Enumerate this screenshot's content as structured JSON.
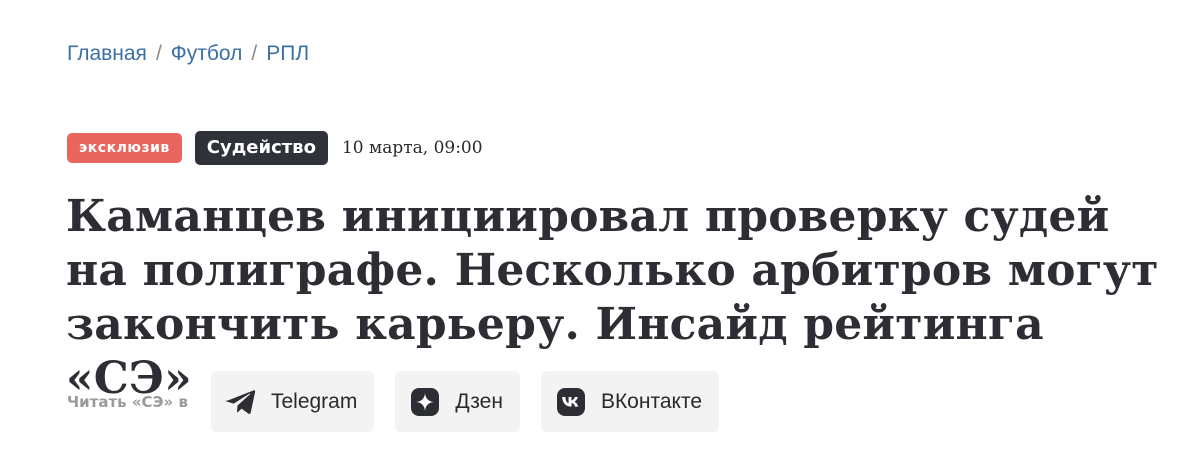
{
  "breadcrumb": {
    "items": [
      "Главная",
      "Футбол",
      "РПЛ"
    ],
    "separator": "/"
  },
  "meta": {
    "exclusive_badge": "эксклюзив",
    "tag": "Судейство",
    "datetime": "10 марта, 09:00"
  },
  "headline": {
    "line1": "Каманцев инициировал проверку судей",
    "line2": "на полиграфе. Несколько арбитров могут",
    "line3": "закончить карьеру. Инсайд рейтинга «СЭ»"
  },
  "read_in": {
    "label": "Читать «СЭ» в",
    "buttons": [
      {
        "label": "Telegram",
        "icon": "telegram-icon"
      },
      {
        "label": "Дзен",
        "icon": "dzen-icon"
      },
      {
        "label": "ВКонтакте",
        "icon": "vk-icon"
      }
    ]
  },
  "colors": {
    "link": "#3d6fa5",
    "exclusive_badge": "#e8665e",
    "tag_badge": "#2f3339",
    "headline": "#2d2e33",
    "muted": "#9a9a9a",
    "social_bg": "#f3f3f3"
  }
}
